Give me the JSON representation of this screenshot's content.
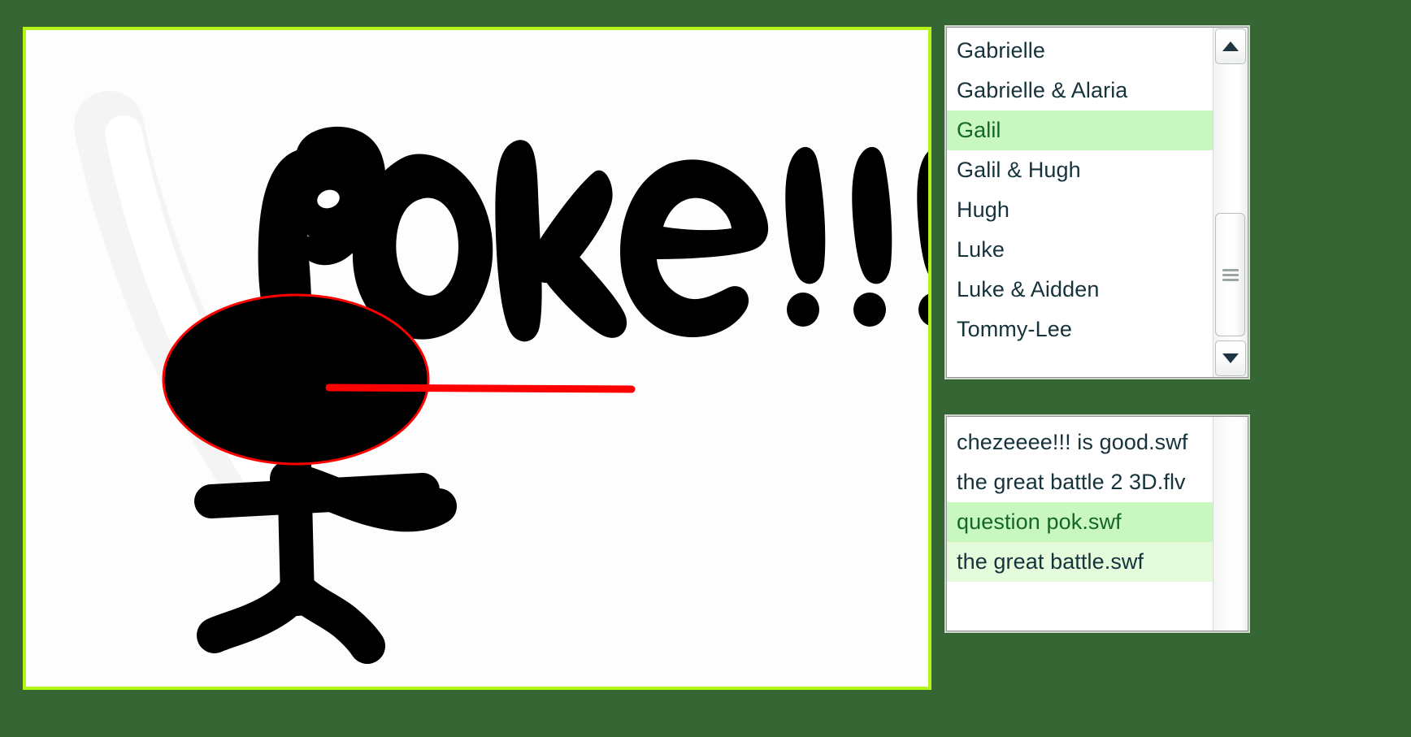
{
  "theme": {
    "page_background": "#356633",
    "canvas_border": "#b4f416",
    "canvas_background": "#fdfdfd",
    "list_text": "#16333c",
    "selected_background": "#c8f7bf",
    "selected_text": "#14662b",
    "hover_background": "#e4fbdc",
    "stroke_black": "#000000",
    "stroke_red": "#ff0000"
  },
  "drawing": {
    "title_text": "poke!!!",
    "figure": "stick-figure-with-oval-head",
    "strokes": [
      "eraser-swath",
      "poke-lettering",
      "oval-head",
      "red-poke-line",
      "arms",
      "torso",
      "legs"
    ]
  },
  "names_list": {
    "selected_value": "Galil",
    "items": [
      {
        "label": "Gabrielle",
        "state": "normal"
      },
      {
        "label": "Gabrielle & Alaria",
        "state": "normal"
      },
      {
        "label": "Galil",
        "state": "selected"
      },
      {
        "label": "Galil & Hugh",
        "state": "normal"
      },
      {
        "label": "Hugh",
        "state": "normal"
      },
      {
        "label": "Luke",
        "state": "normal"
      },
      {
        "label": "Luke & Aidden",
        "state": "normal"
      },
      {
        "label": "Tommy-Lee",
        "state": "normal"
      }
    ],
    "scrollbar": {
      "up_icon": "triangle-up-icon",
      "down_icon": "triangle-down-icon",
      "grip_icon": "grip-lines-icon",
      "has_thumb": true
    }
  },
  "files_list": {
    "selected_value": "question pok.swf",
    "items": [
      {
        "label": "chezeeee!!! is good.swf",
        "state": "normal"
      },
      {
        "label": "the great battle 2 3D.flv",
        "state": "normal"
      },
      {
        "label": "question pok.swf",
        "state": "selected"
      },
      {
        "label": "the great battle.swf",
        "state": "hovered"
      }
    ],
    "scrollbar": {
      "has_thumb": false
    }
  }
}
